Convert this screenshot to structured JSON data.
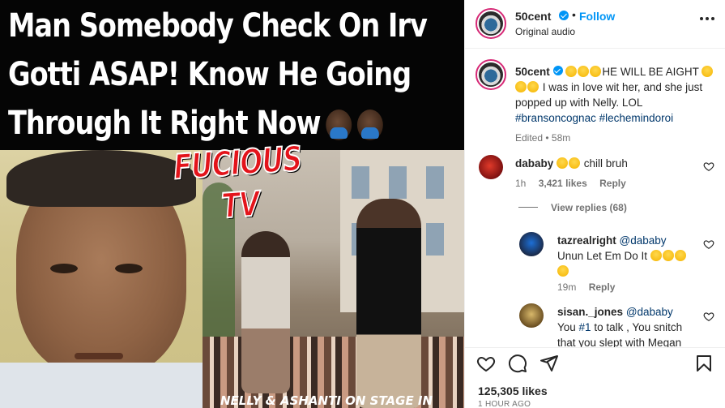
{
  "media": {
    "headline_lines": [
      "Man Somebody Check On Irv",
      "Gotti ASAP! Know He Going",
      "Through It Right Now"
    ],
    "watermark": "FUCIOUS TV",
    "video_caption": "NELLY & ASHANTI ON STAGE IN"
  },
  "header": {
    "username": "50cent",
    "dot": "•",
    "follow_label": "Follow",
    "audio_label": "Original audio",
    "more_icon": "more-horizontal-icon"
  },
  "caption": {
    "username": "50cent",
    "text": "HE WILL BE AIGHT",
    "text2": "I was in love wit her, and she just popped up with Nelly. LOL",
    "hashtags": "#bransoncognac #lechemindoroi",
    "edited": "Edited",
    "time": "58m"
  },
  "comments": [
    {
      "username": "dababy",
      "text": "chill bruh",
      "time": "1h",
      "likes": "3,421 likes",
      "reply": "Reply",
      "view_replies": "View replies (68)"
    },
    {
      "username": "tazrealright",
      "mention": "@dababy",
      "text": "Unun Let Em Do It",
      "time": "19m",
      "reply": "Reply"
    },
    {
      "username": "sisan._jones",
      "mention": "@dababy",
      "text_a": "You ",
      "text_link": "#1",
      "text_b": " to talk , You snitch",
      "text_c": "that you slept with Megan"
    }
  ],
  "actions": {
    "likes": "125,305 likes",
    "time_ago": "1 HOUR AGO"
  },
  "colors": {
    "accent": "#0095f6",
    "link": "#00376b",
    "muted": "#737373",
    "watermark": "#e3141b"
  }
}
